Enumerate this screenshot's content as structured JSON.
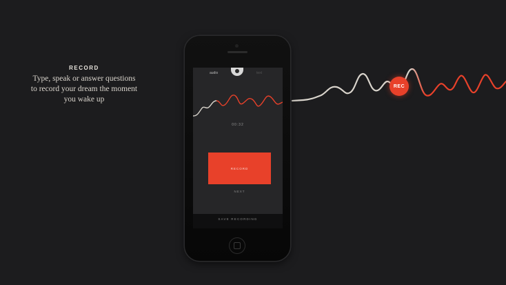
{
  "caption": {
    "heading": "RECORD",
    "lines": [
      "Type, speak or answer questions",
      "to record your dream the moment",
      "you wake up"
    ]
  },
  "badge": {
    "label": "REC"
  },
  "screen": {
    "tabs": {
      "left": "audio",
      "right": "text"
    },
    "timer": "00:32",
    "record_button": "RECORD",
    "next_button": "NEXT",
    "bottom_label": "SAVE RECORDING"
  },
  "colors": {
    "accent": "#e8412a",
    "background": "#1c1c1e",
    "wave_light": "#d9d4cc"
  },
  "icons": [
    "camera-icon",
    "speaker-icon",
    "home-button-icon",
    "mic-icon"
  ]
}
